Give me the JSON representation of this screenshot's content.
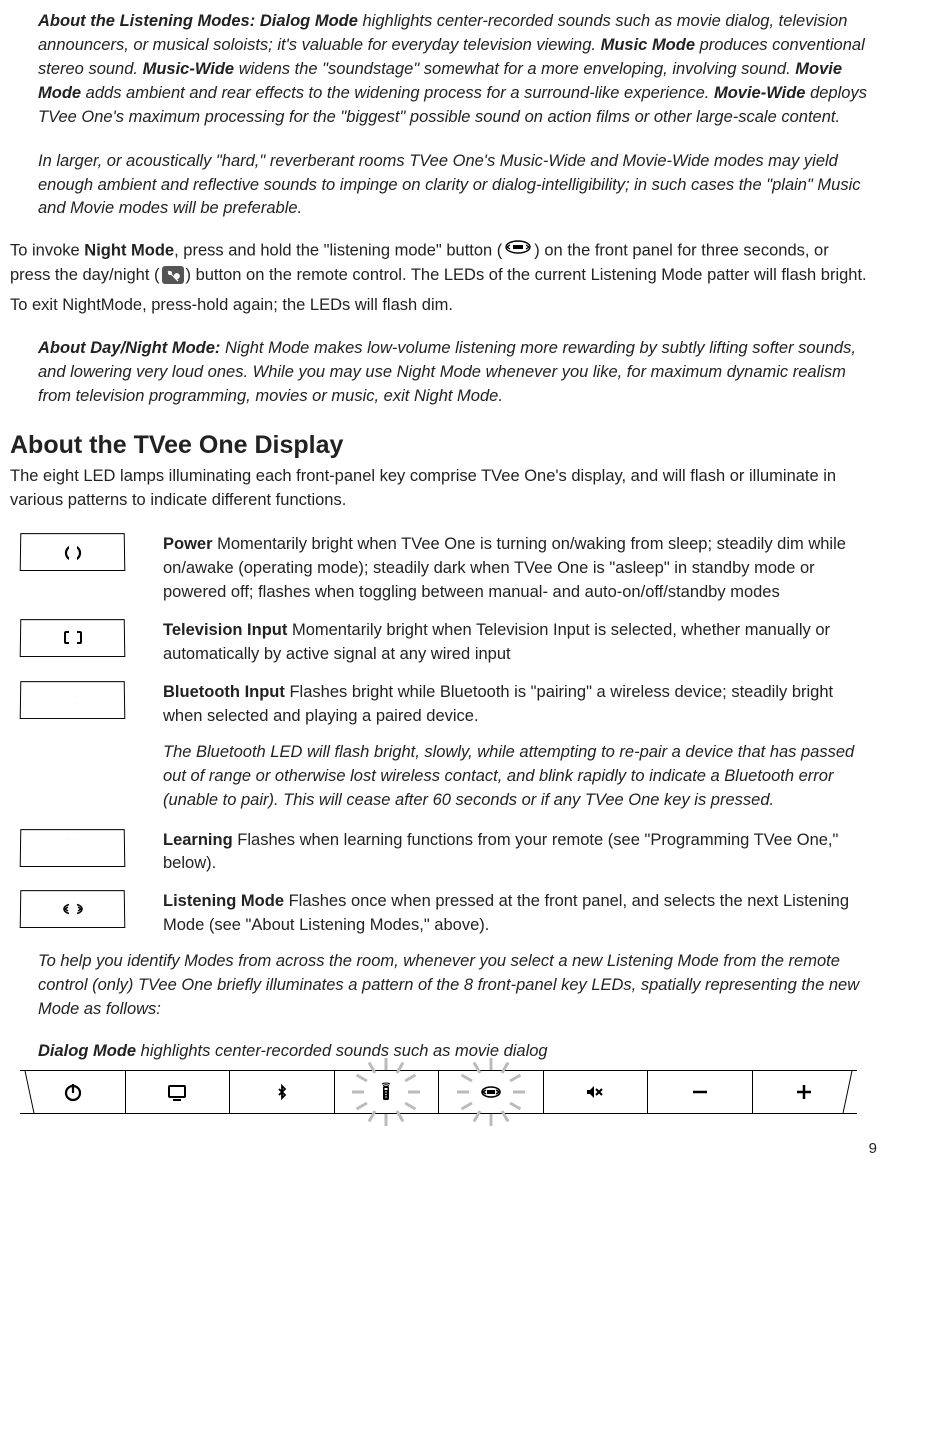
{
  "listening_modes": {
    "heading": "About the Listening Modes:  ",
    "dialog_label": "Dialog Mode",
    "dialog_text": " highlights center-recorded sounds such as movie dialog, television announcers, or musical soloists; it's valuable for everyday television viewing. ",
    "music_label": "Music Mode",
    "music_text": " produces conventional stereo sound. ",
    "musicwide_label": "Music-Wide",
    "musicwide_text": " widens the \"soundstage\" somewhat for a more enveloping, involving sound. ",
    "movie_label": "Movie Mode",
    "movie_text": " adds ambient and rear effects to the widening process for a surround-like experience. ",
    "moviewide_label": "Movie-Wide",
    "moviewide_text": " deploys TVee One's maximum processing for the \"biggest\" possible sound on action films or other large-scale content.",
    "room_note": "In larger, or acoustically \"hard,\" reverberant rooms TVee One's Music-Wide and Movie-Wide modes may yield enough ambient and reflective sounds to impinge on clarity or dialog-intelligibility; in such cases the \"plain\" Music and Movie modes will be preferable."
  },
  "night_mode": {
    "intro_a": "To invoke ",
    "label": "Night Mode",
    "intro_b": ", press and hold the \"listening mode\" button (",
    "intro_c": ") on the front panel for three seconds, or press the day/night (",
    "intro_d": ") button on the remote control. The LEDs of the current Listening Mode patter will flash bright.",
    "exit": "To exit NightMode, press-hold again; the LEDs will flash dim.",
    "about_heading": "About Day/Night Mode:  ",
    "about_text": "Night Mode makes low-volume listening more rewarding by subtly lifting softer sounds, and lowering very loud ones. While you may use Night Mode whenever you like, for maximum dynamic realism from television programming, movies or music, exit Night Mode."
  },
  "display": {
    "heading": "About the TVee One Display",
    "intro": "The eight LED lamps illuminating each front-panel key comprise TVee One's display, and will flash or illuminate in various patterns to indicate different functions.",
    "keys": {
      "power": {
        "label": "Power",
        "text": " Momentarily bright when TVee One is turning on/waking from sleep; steadily dim while on/awake (operating mode); steadily dark when TVee One is \"asleep\" in standby mode or powered off; flashes when toggling between manual- and auto-on/off/standby modes"
      },
      "tv": {
        "label": "Television Input",
        "text": " Momentarily bright when Television Input is selected, whether manually or automatically by active signal at any wired input"
      },
      "bt": {
        "label": "Bluetooth Input",
        "text": " Flashes bright while Bluetooth is \"pairing\" a wireless device; steadily bright when selected and playing a paired device."
      },
      "bt_note": "The Bluetooth LED will flash bright, slowly, while attempting to re-pair a device that has passed out of range or otherwise lost wireless contact, and blink rapidly to indicate a Bluetooth error (unable to pair). This will cease after 60 seconds or if any TVee One key is pressed.",
      "learning": {
        "label": "Learning",
        "text": "  Flashes when learning functions from your remote (see \"Programming TVee One,\" below)."
      },
      "mode": {
        "label": "Listening Mode",
        "text": "  Flashes once when pressed at the front panel, and selects the next Listening Mode (see \"About Listening Modes,\" above)."
      }
    },
    "pattern_intro": "To help you identify Modes from across the room, whenever you select a new Listening Mode from the remote control (only) TVee One briefly illuminates a pattern of the 8 front-panel key LEDs, spatially representing the new Mode as follows:",
    "dialog_pattern_label": "Dialog Mode",
    "dialog_pattern_text": " highlights center-recorded sounds such as movie dialog"
  },
  "page_number": "9"
}
